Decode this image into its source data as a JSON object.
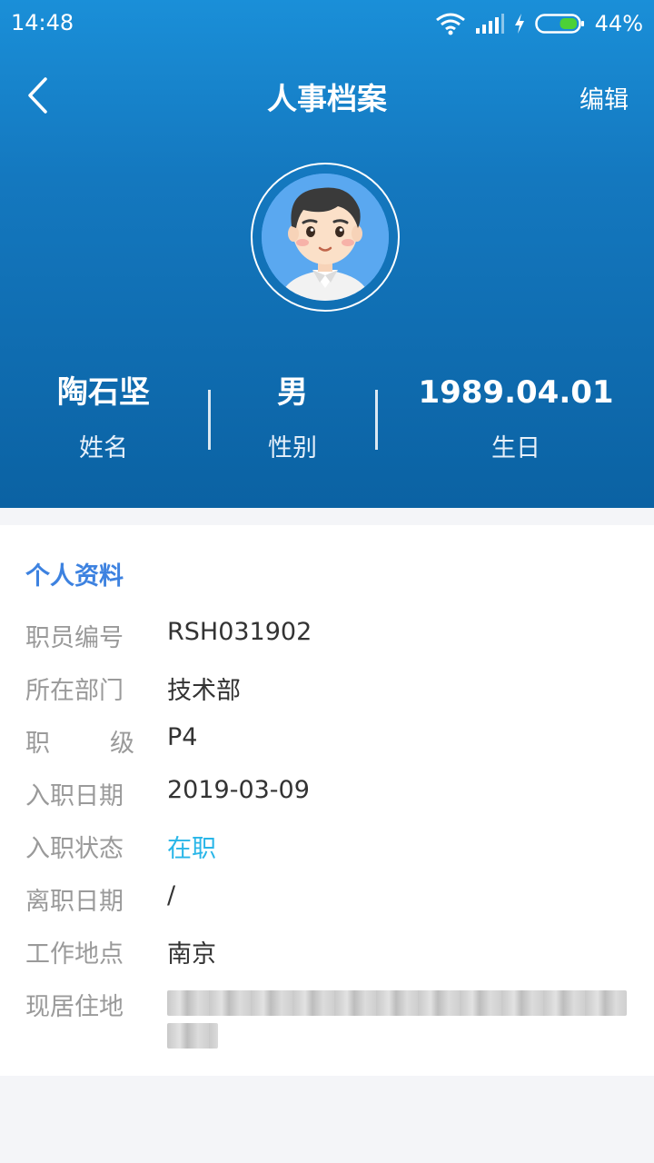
{
  "status_bar": {
    "time": "14:48",
    "battery_percent": "44%",
    "battery_level": 0.44,
    "icons": [
      "wifi-icon",
      "signal-icon",
      "charging-icon",
      "battery-icon"
    ]
  },
  "navbar": {
    "title": "人事档案",
    "edit_label": "编辑",
    "back_icon": "chevron-left-icon"
  },
  "profile": {
    "stats": [
      {
        "value": "陶石坚",
        "label": "姓名"
      },
      {
        "value": "男",
        "label": "性别"
      },
      {
        "value": "1989.04.01",
        "label": "生日"
      }
    ]
  },
  "details": {
    "section_title": "个人资料",
    "rows": [
      {
        "label": "职员编号",
        "value": "RSH031902"
      },
      {
        "label": "所在部门",
        "value": "技术部"
      },
      {
        "label": "职　　级",
        "label_chars": [
          "职",
          "级"
        ],
        "value": "P4"
      },
      {
        "label": "入职日期",
        "value": "2019-03-09"
      },
      {
        "label": "入职状态",
        "value": "在职"
      },
      {
        "label": "离职日期",
        "value": "/"
      },
      {
        "label": "工作地点",
        "value": "南京"
      },
      {
        "label": "现居住地",
        "value": ""
      }
    ]
  },
  "colors": {
    "header_top": "#1a8fd8",
    "header_bottom": "#0b62a3",
    "section_title": "#3d82e0",
    "status_active": "#29b6e8",
    "battery_fill": "#4cd137"
  }
}
